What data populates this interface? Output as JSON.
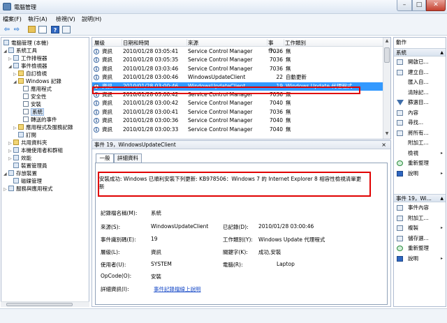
{
  "window": {
    "title": "電腦管理",
    "min": "–",
    "max": "□",
    "close": "✕"
  },
  "menu": [
    "檔案(F)",
    "執行(A)",
    "檢視(V)",
    "說明(H)"
  ],
  "toolbar": {
    "back": "⇦",
    "forward": "⇨",
    "help": "?"
  },
  "tree": [
    {
      "label": "電腦管理 (本機)",
      "arrow": ""
    },
    {
      "label": "系統工具",
      "arrow": "◢"
    },
    {
      "label": "工作排程器",
      "arrow": "▷"
    },
    {
      "label": "事件檢視器",
      "arrow": "◢"
    },
    {
      "label": "自訂檢視",
      "arrow": "▷"
    },
    {
      "label": "Windows 記錄",
      "arrow": "◢"
    },
    {
      "label": "應用程式",
      "arrow": ""
    },
    {
      "label": "安全性",
      "arrow": ""
    },
    {
      "label": "安裝",
      "arrow": ""
    },
    {
      "label": "系統",
      "arrow": ""
    },
    {
      "label": "轉送的事件",
      "arrow": ""
    },
    {
      "label": "應用程式及服務記錄",
      "arrow": "▷"
    },
    {
      "label": "訂閱",
      "arrow": ""
    },
    {
      "label": "共用資料夾",
      "arrow": "▷"
    },
    {
      "label": "本機使用者和群組",
      "arrow": "▷"
    },
    {
      "label": "效能",
      "arrow": "▷"
    },
    {
      "label": "裝置管理員",
      "arrow": ""
    },
    {
      "label": "存放裝置",
      "arrow": "◢"
    },
    {
      "label": "磁碟管理",
      "arrow": ""
    },
    {
      "label": "服務與應用程式",
      "arrow": "▷"
    }
  ],
  "list": {
    "columns": [
      "層級",
      "日期和時間",
      "來源",
      "事件...",
      "工作類別"
    ],
    "rows": [
      {
        "level": "資訊",
        "datetime": "2010/01/28 03:05:41",
        "source": "Service Control Manager",
        "event_id": "7036",
        "category": "無"
      },
      {
        "level": "資訊",
        "datetime": "2010/01/28 03:05:35",
        "source": "Service Control Manager",
        "event_id": "7036",
        "category": "無"
      },
      {
        "level": "資訊",
        "datetime": "2010/01/28 03:03:46",
        "source": "Service Control Manager",
        "event_id": "7036",
        "category": "無"
      },
      {
        "level": "資訊",
        "datetime": "2010/01/28 03:00:46",
        "source": "WindowsUpdateClient",
        "event_id": "22",
        "category": "自動更新"
      },
      {
        "level": "資訊",
        "datetime": "2010/01/28 03:00:46",
        "source": "WindowsUpdateClient",
        "event_id": "19",
        "category": "Windows Update 代理程式"
      },
      {
        "level": "資訊",
        "datetime": "2010/01/28 03:00:42",
        "source": "Service Control Manager",
        "event_id": "7036",
        "category": "無"
      },
      {
        "level": "資訊",
        "datetime": "2010/01/28 03:00:42",
        "source": "Service Control Manager",
        "event_id": "7040",
        "category": "無"
      },
      {
        "level": "資訊",
        "datetime": "2010/01/28 03:00:41",
        "source": "Service Control Manager",
        "event_id": "7036",
        "category": "無"
      },
      {
        "level": "資訊",
        "datetime": "2010/01/28 03:00:36",
        "source": "Service Control Manager",
        "event_id": "7040",
        "category": "無"
      },
      {
        "level": "資訊",
        "datetime": "2010/01/28 03:00:33",
        "source": "Service Control Manager",
        "event_id": "7040",
        "category": "無"
      }
    ]
  },
  "detail": {
    "header": "事件 19，WindowsUpdateClient",
    "close": "×",
    "tabs": [
      "一般",
      "詳細資料"
    ],
    "description": "安裝成功: Windows 已順利安裝下列更新: KB978506：Windows 7 的 Internet Explorer 8 相容性檢視清單更新",
    "fields": {
      "log_name_label": "記錄檔名稱(M):",
      "log_name": "系統",
      "source_label": "來源(S):",
      "source": "WindowsUpdateClient",
      "logged_label": "已記錄(D):",
      "logged": "2010/01/28 03:00:46",
      "event_id_label": "事件識別碼(E):",
      "event_id": "19",
      "task_label": "工作類別(Y):",
      "task": "Windows Update 代理程式",
      "level_label": "層級(L):",
      "level": "資訊",
      "keywords_label": "關鍵字(K):",
      "keywords": "成功,安裝",
      "user_label": "使用者(U):",
      "user": "SYSTEM",
      "computer_label": "電腦(R):",
      "computer": "Laptop",
      "opcode_label": "OpCode(O):",
      "opcode": "安裝",
      "more_label": "詳細資訊(I):",
      "more_link": "事件記錄檔線上說明"
    }
  },
  "actions": {
    "title": "動作",
    "section1": "系統",
    "items1": [
      {
        "label": "開啟已...",
        "icon": "open-log-icon"
      },
      {
        "label": "建立自...",
        "icon": "create-view-icon"
      },
      {
        "label": "匯入自...",
        "icon": ""
      },
      {
        "label": "清除記...",
        "icon": ""
      },
      {
        "label": "篩選目...",
        "icon": "filter-icon"
      },
      {
        "label": "內容",
        "icon": "properties-icon"
      },
      {
        "label": "尋找...",
        "icon": "find-icon"
      },
      {
        "label": "將所有...",
        "icon": "save-icon"
      },
      {
        "label": "附加工...",
        "icon": ""
      },
      {
        "label": "檢視",
        "icon": "",
        "submenu": "▸"
      },
      {
        "label": "重新整理",
        "icon": "refresh-icon"
      },
      {
        "label": "說明",
        "icon": "help-icon",
        "submenu": "▸"
      }
    ],
    "section2": "事件 19，Wi...",
    "items2": [
      {
        "label": "事件內容",
        "icon": "event-properties-icon"
      },
      {
        "label": "附加工...",
        "icon": "attach-task-icon"
      },
      {
        "label": "複製",
        "icon": "copy-icon",
        "submenu": "▸"
      },
      {
        "label": "儲存選...",
        "icon": "save-selected-icon"
      },
      {
        "label": "重新整理",
        "icon": "refresh-icon"
      },
      {
        "label": "說明",
        "icon": "help-icon",
        "submenu": "▸"
      }
    ]
  }
}
